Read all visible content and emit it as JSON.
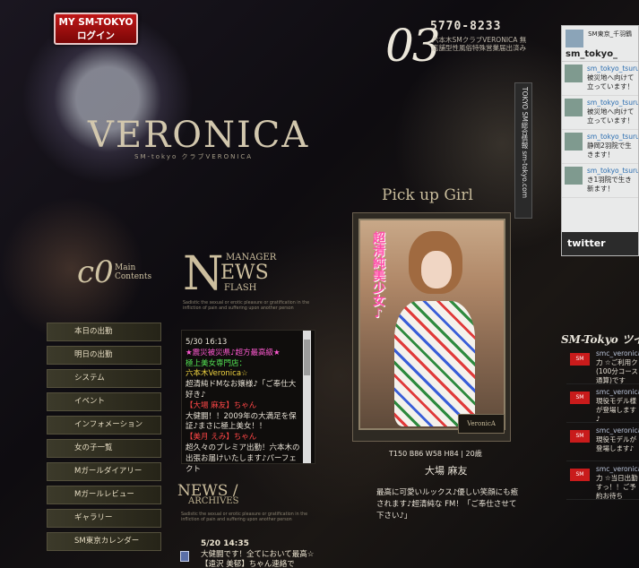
{
  "header": {
    "login_line1": "MY SM-TOKYO",
    "login_line2": "ログイン",
    "phone": "5770-8233",
    "address": "六本木SMクラブVERONICA 無店舗型性風俗特殊営業届出済み",
    "big_number": "03",
    "logo": "VERONICA",
    "logo_sub": "SM-tokyo クラブVERONICA"
  },
  "side_band": {
    "label": "TOKYO SM総合情報 sm-tokyo.com"
  },
  "pickup": {
    "title": "Pick up Girl",
    "tagline": "超清純美少女♪",
    "stamp": "VeronicA",
    "stats": "T150 B86 W58 H84 | 20歳",
    "name": "大場 麻友",
    "message": "最高に可愛いルックス♪優しい笑顔にも癒されます♪超清純な FM！「ご奉仕させて下さい♪」"
  },
  "main_contents": {
    "c": "c0",
    "label_line1": "Main",
    "label_line2": "Contents"
  },
  "menu": [
    "本日の出勤",
    "明日の出勤",
    "システム",
    "イベント",
    "インフォメーション",
    "女の子一覧",
    "Mガールダイアリー",
    "Mガールレビュー",
    "ギャラリー",
    "SM東京カレンダー"
  ],
  "news": {
    "manager": "MANAGER",
    "news_rest": "EWS",
    "news_first": "N",
    "flash": "FLASH",
    "tag": "Sadistic the sexual or erotic pleasure or gratification in the infliction of pain and suffering upon another person",
    "items": [
      "5/30 16:13",
      "★震災被災県♪超方最高級★",
      "極上美女専門店：",
      "六本木Veronica☆",
      "超清純ドMなお嬢様♪「ご奉仕大好き♪",
      "【大場 麻友】ちゃん",
      "大健闘！！2009年の大満足を保証♪まさに極上美女！！",
      "【美月 えみ】ちゃん",
      "超久々のプレミア出勤！六本木の出張お届けいたします♪パーフェクト"
    ]
  },
  "archives": {
    "title": "NEWS /",
    "subtitle": "ARCHIVES",
    "tag": "Sadistic the sexual or erotic pleasure or gratification in the infliction of pain and suffering upon another person",
    "date": "5/20 14:35",
    "text": "大健闘です！全てにおいて最高☆【遠沢 美郁】ちゃん連絡で"
  },
  "twitter": {
    "head1": "SM東京_千羽鶴",
    "head2": "sm_tokyo_",
    "items": [
      {
        "user": "sm_tokyo_tsuru",
        "text": "被災地へ向けて立っています！"
      },
      {
        "user": "sm_tokyo_tsuru",
        "text": "被災地へ向けて立っています！"
      },
      {
        "user": "sm_tokyo_tsuru",
        "text": "静岡2羽院で生きます！"
      },
      {
        "user": "sm_tokyo_tsuru",
        "text": "き1羽院で生き新ます！"
      }
    ],
    "footer": "twitter"
  },
  "sm_twitter": {
    "title": "SM-Tokyo ツイ",
    "items": [
      {
        "user": "smc_veronica",
        "text": "力 ☆ご利用ク(100分コース通算)です"
      },
      {
        "user": "smc_veronica",
        "text": "現役モデル様が登場します♪"
      },
      {
        "user": "smc_veronica",
        "text": "現役モデルが登場します♪"
      },
      {
        "user": "smc_veronica",
        "text": "力 ☆当日出勤すっ！！ご予約お待ち"
      }
    ]
  }
}
